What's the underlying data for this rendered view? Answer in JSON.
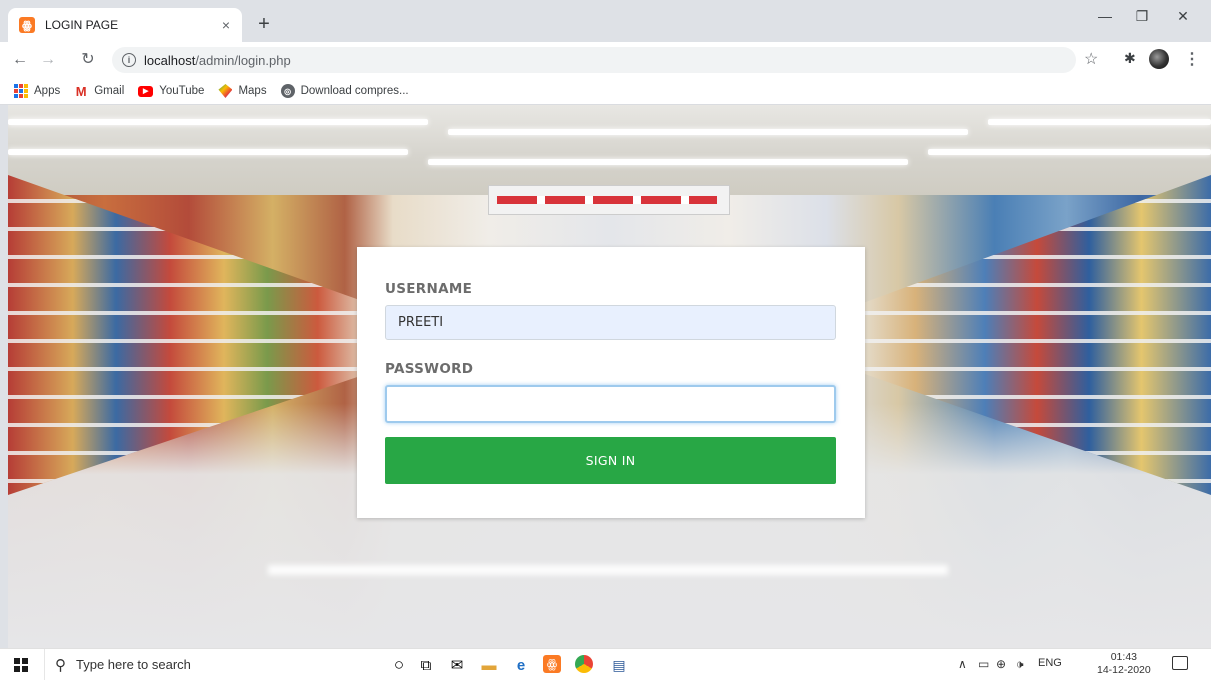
{
  "browser": {
    "tab_title": "LOGIN PAGE",
    "tab_favicon": "xampp-icon",
    "tab_close": "×",
    "new_tab": "+",
    "url_host": "localhost",
    "url_path": "/admin/login.php",
    "window_min": "—",
    "window_restore": "❐",
    "window_close": "✕"
  },
  "bookmarks": [
    {
      "label": "Apps",
      "icon": "apps-grid-icon"
    },
    {
      "label": "Gmail",
      "icon": "gmail-icon"
    },
    {
      "label": "YouTube",
      "icon": "youtube-icon"
    },
    {
      "label": "Maps",
      "icon": "maps-icon"
    },
    {
      "label": "Download compres...",
      "icon": "globe-icon"
    }
  ],
  "login": {
    "username_label": "USERNAME",
    "username_value": "PREETI",
    "password_label": "PASSWORD",
    "password_value": "",
    "signin_label": "SIGN IN",
    "signin_color": "#28a745"
  },
  "taskbar": {
    "search_placeholder": "Type here to search",
    "language": "ENG",
    "time": "01:43",
    "date": "14-12-2020"
  }
}
